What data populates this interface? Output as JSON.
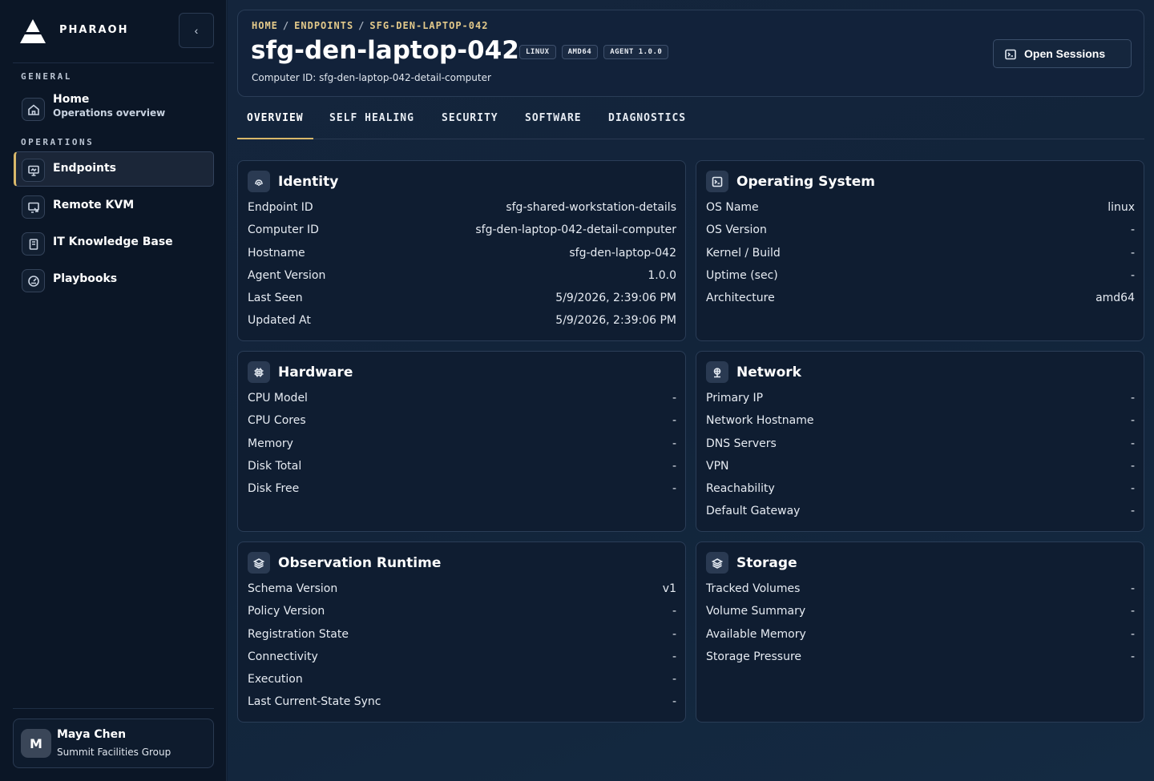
{
  "app": {
    "name": "PHARAOH"
  },
  "sidebar": {
    "collapse_icon": "chevron-left-icon",
    "sections": [
      {
        "label": "GENERAL"
      },
      {
        "label": "OPERATIONS"
      }
    ],
    "items": [
      {
        "label": "Home",
        "sub": "Operations overview",
        "icon": "home-icon"
      },
      {
        "label": "Endpoints",
        "icon": "monitor-icon",
        "active": true
      },
      {
        "label": "Remote KVM",
        "icon": "remote-screen-icon"
      },
      {
        "label": "IT Knowledge Base",
        "icon": "book-icon"
      },
      {
        "label": "Playbooks",
        "icon": "gauge-icon"
      }
    ],
    "user": {
      "initial": "M",
      "name": "Maya Chen",
      "org": "Summit Facilities Group"
    }
  },
  "header": {
    "breadcrumb": [
      "HOME",
      "ENDPOINTS",
      "SFG-DEN-LAPTOP-042"
    ],
    "title": "sfg-den-laptop-042",
    "badges": [
      "LINUX",
      "AMD64",
      "AGENT 1.0.0"
    ],
    "computer_id": "Computer ID: sfg-den-laptop-042-detail-computer",
    "open_sessions_label": "Open Sessions"
  },
  "tabs": [
    "OVERVIEW",
    "SELF HEALING",
    "SECURITY",
    "SOFTWARE",
    "DIAGNOSTICS"
  ],
  "cards": {
    "identity": {
      "title": "Identity",
      "icon": "fingerprint-icon",
      "rows": [
        {
          "k": "Endpoint ID",
          "v": "sfg-shared-workstation-details"
        },
        {
          "k": "Computer ID",
          "v": "sfg-den-laptop-042-detail-computer"
        },
        {
          "k": "Hostname",
          "v": "sfg-den-laptop-042"
        },
        {
          "k": "Agent Version",
          "v": "1.0.0"
        },
        {
          "k": "Last Seen",
          "v": "5/9/2026, 2:39:06 PM"
        },
        {
          "k": "Updated At",
          "v": "5/9/2026, 2:39:06 PM"
        }
      ]
    },
    "os": {
      "title": "Operating System",
      "icon": "terminal-icon",
      "rows": [
        {
          "k": "OS Name",
          "v": "linux"
        },
        {
          "k": "OS Version",
          "v": "-"
        },
        {
          "k": "Kernel / Build",
          "v": "-"
        },
        {
          "k": "Uptime (sec)",
          "v": "-"
        },
        {
          "k": "Architecture",
          "v": "amd64"
        }
      ]
    },
    "hardware": {
      "title": "Hardware",
      "icon": "cpu-icon",
      "rows": [
        {
          "k": "CPU Model",
          "v": "-"
        },
        {
          "k": "CPU Cores",
          "v": "-"
        },
        {
          "k": "Memory",
          "v": "-"
        },
        {
          "k": "Disk Total",
          "v": "-"
        },
        {
          "k": "Disk Free",
          "v": "-"
        }
      ]
    },
    "network": {
      "title": "Network",
      "icon": "network-icon",
      "rows": [
        {
          "k": "Primary IP",
          "v": "-"
        },
        {
          "k": "Network Hostname",
          "v": "-"
        },
        {
          "k": "DNS Servers",
          "v": "-"
        },
        {
          "k": "VPN",
          "v": "-"
        },
        {
          "k": "Reachability",
          "v": "-"
        },
        {
          "k": "Default Gateway",
          "v": "-"
        }
      ]
    },
    "runtime": {
      "title": "Observation Runtime",
      "icon": "layers-icon",
      "rows": [
        {
          "k": "Schema Version",
          "v": "v1"
        },
        {
          "k": "Policy Version",
          "v": "-"
        },
        {
          "k": "Registration State",
          "v": "-"
        },
        {
          "k": "Connectivity",
          "v": "-"
        },
        {
          "k": "Execution",
          "v": "-"
        },
        {
          "k": "Last Current-State Sync",
          "v": "-"
        }
      ]
    },
    "storage": {
      "title": "Storage",
      "icon": "layers-icon",
      "rows": [
        {
          "k": "Tracked Volumes",
          "v": "-"
        },
        {
          "k": "Volume Summary",
          "v": "-"
        },
        {
          "k": "Available Memory",
          "v": "-"
        },
        {
          "k": "Storage Pressure",
          "v": "-"
        }
      ]
    }
  },
  "colors": {
    "accent": "#d9b86a",
    "breadcrumb": "#e3c98a",
    "card_bg": "#0f1d31",
    "sidebar_bg": "#0b1626"
  }
}
